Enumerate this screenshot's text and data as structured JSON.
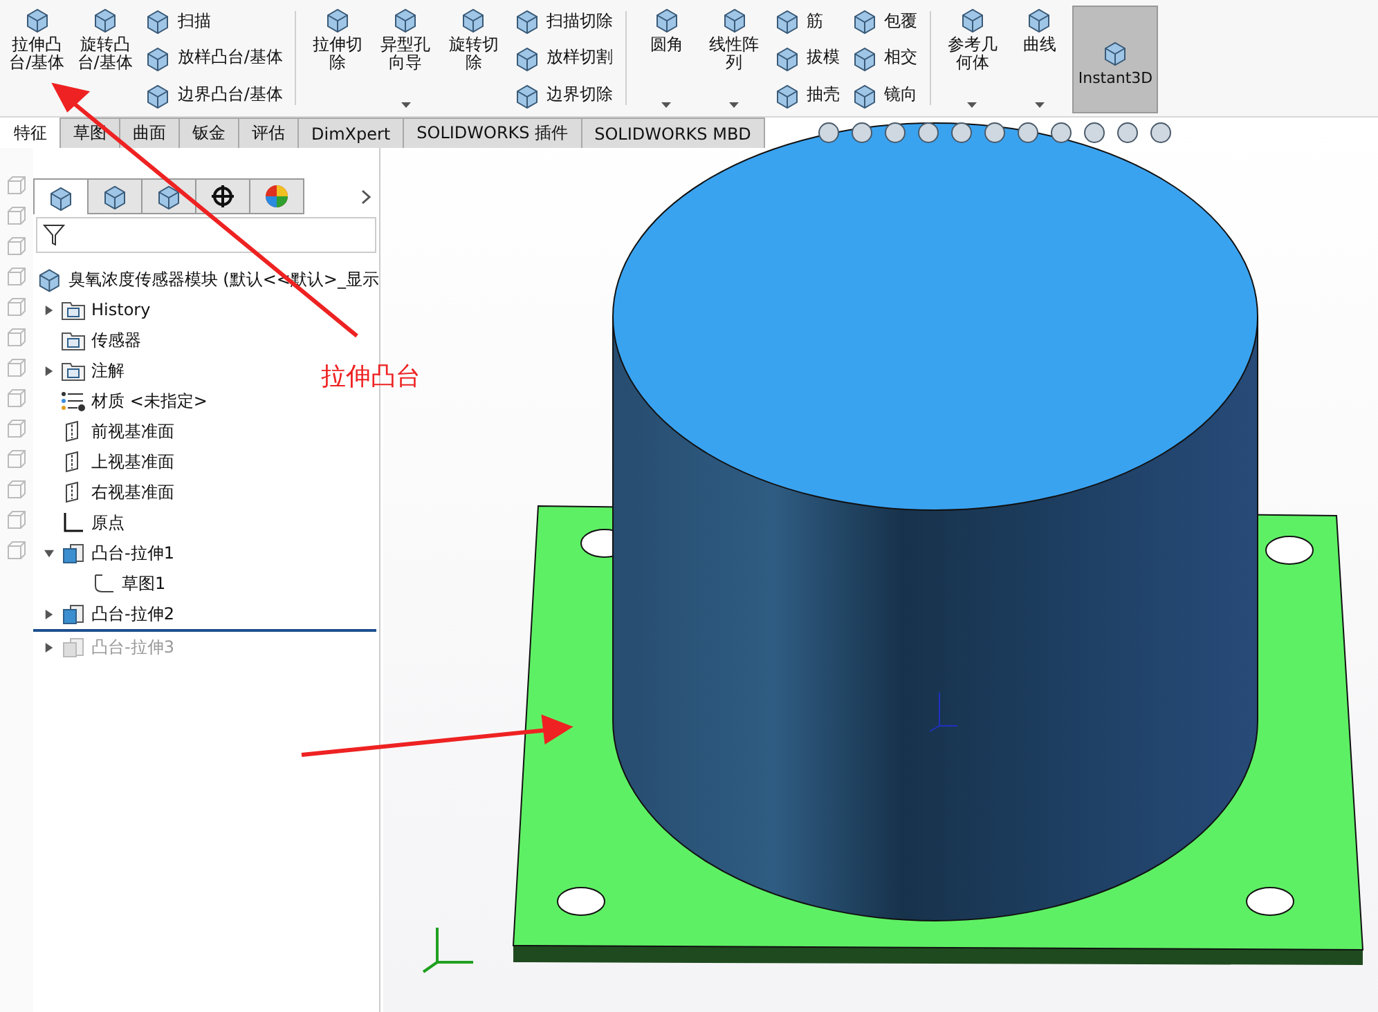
{
  "ribbon": [
    {
      "kind": "large",
      "label": "拉伸凸台/基体",
      "dropdown": false,
      "selected": false
    },
    {
      "kind": "large",
      "label": "旋转凸台/基体",
      "dropdown": false,
      "selected": false
    },
    {
      "kind": "stack",
      "items": [
        "扫描",
        "放样凸台/基体",
        "边界凸台/基体"
      ]
    },
    {
      "kind": "separator"
    },
    {
      "kind": "large",
      "label": "拉伸切除",
      "dropdown": false,
      "selected": false
    },
    {
      "kind": "large",
      "label": "异型孔向导",
      "dropdown": true,
      "selected": false
    },
    {
      "kind": "large",
      "label": "旋转切除",
      "dropdown": false,
      "selected": false
    },
    {
      "kind": "stack",
      "items": [
        "扫描切除",
        "放样切割",
        "边界切除"
      ]
    },
    {
      "kind": "separator"
    },
    {
      "kind": "large",
      "label": "圆角",
      "dropdown": true,
      "selected": false
    },
    {
      "kind": "large",
      "label": "线性阵列",
      "dropdown": true,
      "selected": false
    },
    {
      "kind": "stack",
      "items": [
        "筋",
        "拔模",
        "抽壳"
      ]
    },
    {
      "kind": "stack",
      "items": [
        "包覆",
        "相交",
        "镜向"
      ]
    },
    {
      "kind": "separator"
    },
    {
      "kind": "large",
      "label": "参考几何体",
      "dropdown": true,
      "selected": false
    },
    {
      "kind": "large",
      "label": "曲线",
      "dropdown": true,
      "selected": false
    },
    {
      "kind": "large",
      "label": "Instant3D",
      "dropdown": false,
      "selected": true
    }
  ],
  "tabs": [
    {
      "label": "特征",
      "selected": true
    },
    {
      "label": "草图",
      "selected": false
    },
    {
      "label": "曲面",
      "selected": false
    },
    {
      "label": "钣金",
      "selected": false
    },
    {
      "label": "评估",
      "selected": false
    },
    {
      "label": "DimXpert",
      "selected": false
    },
    {
      "label": "SOLIDWORKS 插件",
      "selected": false
    },
    {
      "label": "SOLIDWORKS MBD",
      "selected": false
    }
  ],
  "panel_tabs": [
    {
      "selected": true
    },
    {
      "selected": false
    },
    {
      "selected": false
    },
    {
      "selected": false
    },
    {
      "selected": false
    }
  ],
  "tree": {
    "root": "臭氧浓度传感器模块  (默认<<默认>_显示",
    "items": [
      {
        "kind": "folder",
        "label": "History",
        "expanded": false,
        "disabled": false
      },
      {
        "kind": "sensor",
        "label": "传感器",
        "disabled": false
      },
      {
        "kind": "annotation",
        "label": "注解",
        "expanded": false,
        "disabled": false
      },
      {
        "kind": "material",
        "label": "材质 <未指定>",
        "disabled": false
      },
      {
        "kind": "plane",
        "label": "前视基准面",
        "disabled": false
      },
      {
        "kind": "plane",
        "label": "上视基准面",
        "disabled": false
      },
      {
        "kind": "plane",
        "label": "右视基准面",
        "disabled": false
      },
      {
        "kind": "origin",
        "label": "原点",
        "disabled": false
      },
      {
        "kind": "feature",
        "label": "凸台-拉伸1",
        "expanded": true,
        "disabled": false,
        "children": [
          {
            "kind": "sketch",
            "label": "草图1",
            "disabled": false
          }
        ]
      },
      {
        "kind": "feature",
        "label": "凸台-拉伸2",
        "expanded": false,
        "disabled": false
      },
      {
        "kind": "feature",
        "label": "凸台-拉伸3",
        "expanded": false,
        "disabled": true
      }
    ]
  },
  "annotation": {
    "label": "拉伸凸台"
  }
}
